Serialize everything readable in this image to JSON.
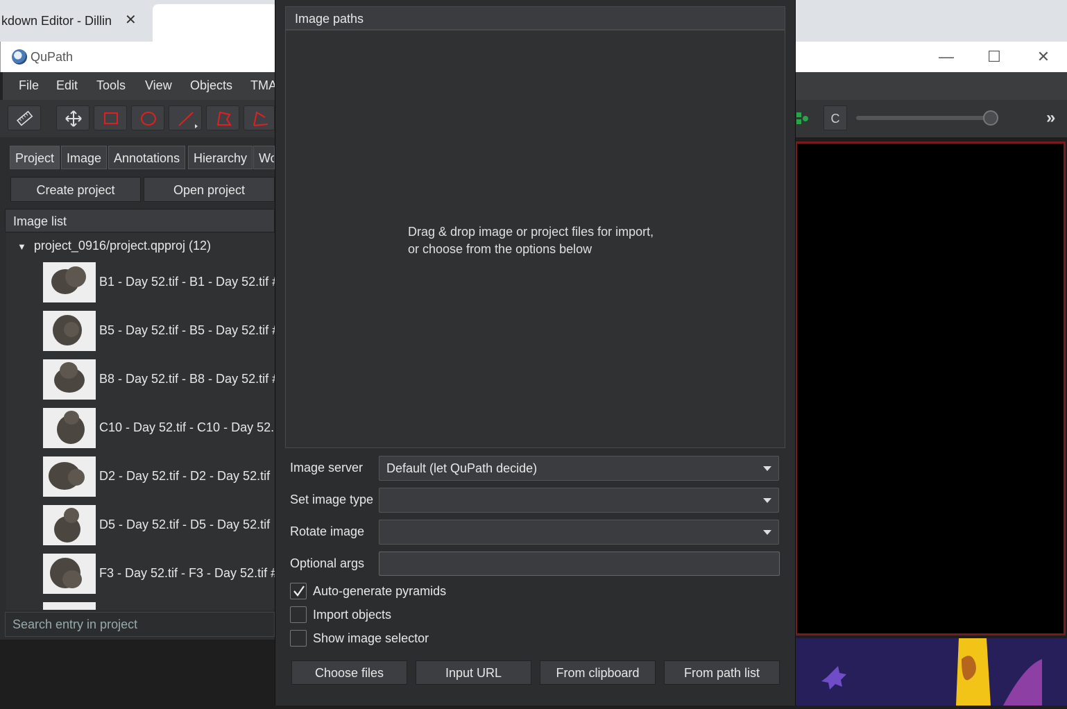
{
  "browser": {
    "tab_title": "kdown Editor - Dillin",
    "tab_close": "✕"
  },
  "window": {
    "title": "QuPath",
    "minimize": "—",
    "maximize": "☐",
    "close": "✕"
  },
  "menu": [
    "File",
    "Edit",
    "Tools",
    "View",
    "Objects",
    "TMA"
  ],
  "toolbar": {
    "channel_label": "C",
    "overflow": "»"
  },
  "left_tabs": [
    "Project",
    "Image",
    "Annotations",
    "Hierarchy",
    "Wo"
  ],
  "project_buttons": {
    "create": "Create project",
    "open": "Open project"
  },
  "image_list": {
    "header": "Image list",
    "root": "project_0916/project.qpproj (12)",
    "items": [
      "B1 - Day 52.tif - B1 - Day 52.tif #",
      "B5 - Day 52.tif - B5 - Day 52.tif #",
      "B8 - Day 52.tif - B8 - Day 52.tif #",
      "C10 - Day 52.tif - C10 - Day 52.",
      "D2 - Day 52.tif - D2 - Day 52.tif",
      "D5 - Day 52.tif - D5 - Day 52.tif",
      "F3 - Day 52.tif - F3 - Day 52.tif #"
    ]
  },
  "search": {
    "placeholder": "Search entry in project"
  },
  "dialog": {
    "header": "Image paths",
    "drop_line1": "Drag & drop image or project files for import,",
    "drop_line2": "or choose from the options below",
    "image_server_label": "Image server",
    "image_server_value": "Default (let QuPath decide)",
    "image_type_label": "Set image type",
    "image_type_value": "",
    "rotate_label": "Rotate image",
    "rotate_value": "",
    "optional_label": "Optional args",
    "optional_value": "",
    "auto_pyramids": {
      "label": "Auto-generate pyramids",
      "checked": true
    },
    "import_objects": {
      "label": "Import objects",
      "checked": false
    },
    "show_selector": {
      "label": "Show image selector",
      "checked": false
    },
    "buttons": {
      "choose": "Choose files",
      "url": "Input URL",
      "clipboard": "From clipboard",
      "pathlist": "From path list"
    }
  },
  "colors": {
    "dialog_bg": "#2b2d2f",
    "viewer_border": "#7a1a1a",
    "accent_red": "#e02020"
  }
}
